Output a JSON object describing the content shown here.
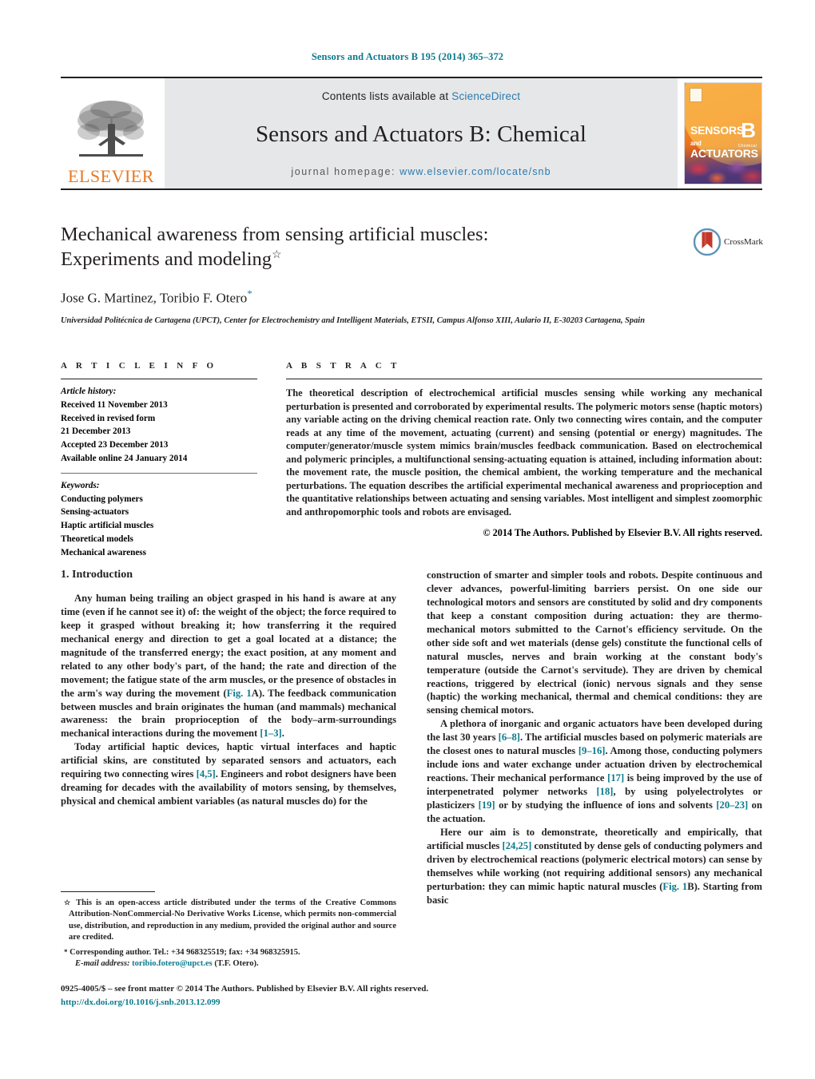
{
  "running_head": "Sensors and Actuators B 195 (2014) 365–372",
  "masthead": {
    "publisher_name": "ELSEVIER",
    "contents_prefix": "Contents lists available at ",
    "contents_link": "ScienceDirect",
    "journal_title": "Sensors and Actuators B: Chemical",
    "homepage_prefix": "journal homepage: ",
    "homepage_url": "www.elsevier.com/locate/snb",
    "cover": {
      "line1": "SENSORS",
      "line1_and": "and",
      "line2": "ACTUATORS",
      "letter": "B",
      "letter_sub": "Chemical"
    }
  },
  "article": {
    "title_line1": "Mechanical awareness from sensing artificial muscles:",
    "title_line2": "Experiments and modeling",
    "title_footnote_mark": "☆",
    "authors": "Jose G. Martinez, Toribio F. Otero",
    "author_corresponding_mark": "*",
    "affiliation": "Universidad Politécnica de Cartagena (UPCT), Center for Electrochemistry and Intelligent Materials, ETSII, Campus Alfonso XIII, Aulario II, E-30203 Cartagena, Spain"
  },
  "crossmark": {
    "label": "CrossMark"
  },
  "article_info": {
    "heading": "A R T I C L E   I N F O",
    "history_label": "Article history:",
    "history": [
      "Received 11 November 2013",
      "Received in revised form",
      "21 December 2013",
      "Accepted 23 December 2013",
      "Available online 24 January 2014"
    ],
    "keywords_label": "Keywords:",
    "keywords": [
      "Conducting polymers",
      "Sensing-actuators",
      "Haptic artificial muscles",
      "Theoretical models",
      "Mechanical awareness"
    ]
  },
  "abstract": {
    "heading": "A B S T R A C T",
    "text": "The theoretical description of electrochemical artificial muscles sensing while working any mechanical perturbation is presented and corroborated by experimental results. The polymeric motors sense (haptic motors) any variable acting on the driving chemical reaction rate. Only two connecting wires contain, and the computer reads at any time of the movement, actuating (current) and sensing (potential or energy) magnitudes. The computer/generator/muscle system mimics brain/muscles feedback communication. Based on electrochemical and polymeric principles, a multifunctional sensing-actuating equation is attained, including information about: the movement rate, the muscle position, the chemical ambient, the working temperature and the mechanical perturbations. The equation describes the artificial experimental mechanical awareness and proprioception and the quantitative relationships between actuating and sensing variables. Most intelligent and simplest zoomorphic and anthropomorphic tools and robots are envisaged.",
    "copyright": "© 2014 The Authors. Published by Elsevier B.V. All rights reserved."
  },
  "body": {
    "section_title": "1.  Introduction",
    "left_paragraph_1_a": "Any human being trailing an object grasped in his hand is aware at any time (even if he cannot see it) of: the weight of the object; the force required to keep it grasped without breaking it; how transferring it the required mechanical energy and direction to get a goal located at a distance; the magnitude of the transferred energy; the exact position, at any moment and related to any other body's part, of the hand; the rate and direction of the movement; the fatigue state of the arm muscles, or the presence of obstacles in the arm's way during the movement (",
    "left_paragraph_1_ref": "Fig. 1",
    "left_paragraph_1_b": "A). The feedback communication between muscles and brain originates the human (and mammals) mechanical awareness: the brain proprioception of the body–arm-surroundings mechanical interactions during the movement ",
    "left_paragraph_1_ref2": "[1–3]",
    "left_paragraph_1_c": ".",
    "left_paragraph_2_a": "Today artificial haptic devices, haptic virtual interfaces and haptic artificial skins, are constituted by separated sensors and actuators, each requiring two connecting wires ",
    "left_paragraph_2_ref": "[4,5]",
    "left_paragraph_2_b": ". Engineers and robot designers have been dreaming for decades with the availability of motors sensing, by themselves, physical and chemical ambient variables (as natural muscles do) for the",
    "right_paragraph_1": "construction of smarter and simpler tools and robots. Despite continuous and clever advances, powerful-limiting barriers persist. On one side our technological motors and sensors are constituted by solid and dry components that keep a constant composition during actuation: they are thermo-mechanical motors submitted to the Carnot's efficiency servitude. On the other side soft and wet materials (dense gels) constitute the functional cells of natural muscles, nerves and brain working at the constant body's temperature (outside the Carnot's servitude). They are driven by chemical reactions, triggered by electrical (ionic) nervous signals and they sense (haptic) the working mechanical, thermal and chemical conditions: they are sensing chemical motors.",
    "right_paragraph_2_a": "A plethora of inorganic and organic actuators have been developed during the last 30 years ",
    "right_paragraph_2_ref1": "[6–8]",
    "right_paragraph_2_b": ". The artificial muscles based on polymeric materials are the closest ones to natural muscles ",
    "right_paragraph_2_ref2": "[9–16]",
    "right_paragraph_2_c": ". Among those, conducting polymers include ions and water exchange under actuation driven by electrochemical reactions. Their mechanical performance ",
    "right_paragraph_2_ref3": "[17]",
    "right_paragraph_2_d": " is being improved by the use of interpenetrated polymer networks ",
    "right_paragraph_2_ref4": "[18]",
    "right_paragraph_2_e": ", by using polyelectrolytes or plasticizers ",
    "right_paragraph_2_ref5": "[19]",
    "right_paragraph_2_f": " or by studying the influence of ions and solvents ",
    "right_paragraph_2_ref6": "[20–23]",
    "right_paragraph_2_g": " on the actuation.",
    "right_paragraph_3_a": "Here our aim is to demonstrate, theoretically and empirically, that artificial muscles ",
    "right_paragraph_3_ref1": "[24,25]",
    "right_paragraph_3_b": " constituted by dense gels of conducting polymers and driven by electrochemical reactions (polymeric electrical motors) can sense by themselves while working (not requiring additional sensors) any mechanical perturbation: they can mimic haptic natural muscles (",
    "right_paragraph_3_ref2": "Fig. 1",
    "right_paragraph_3_c": "B). Starting from basic"
  },
  "footnotes": {
    "license_mark": "☆",
    "license_text": " This is an open-access article distributed under the terms of the Creative Commons Attribution-NonCommercial-No Derivative Works License, which permits non-commercial use, distribution, and reproduction in any medium, provided the original author and source are credited.",
    "corresponding_mark": "*",
    "corresponding_text": " Corresponding author. Tel.: +34 968325519; fax: +34 968325915.",
    "email_label": "E-mail address:",
    "email_address": "toribio.fotero@upct.es",
    "email_owner": "(T.F. Otero)."
  },
  "imprint": {
    "line": "0925-4005/$ – see front matter © 2014 The Authors. Published by Elsevier B.V. All rights reserved.",
    "doi": "http://dx.doi.org/10.1016/j.snb.2013.12.099"
  },
  "colors": {
    "teal_link": "#0b7a8c",
    "blue_link": "#2a7ab0",
    "elsevier_orange": "#e87722",
    "band_gray": "#e6e7e8",
    "text": "#231f20"
  }
}
